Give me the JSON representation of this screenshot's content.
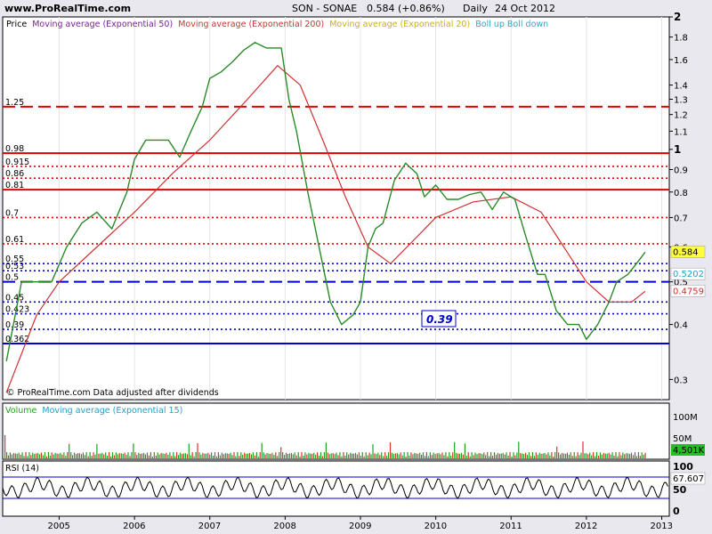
{
  "header": {
    "site": "www.ProRealTime.com",
    "symbol": "SON - SONAE",
    "price": "0.584 (+0.86%)",
    "period": "Daily",
    "date": "24 Oct 2012"
  },
  "legend": {
    "price": "Price",
    "ma50": "Moving average (Exponential 50)",
    "ma200": "Moving average (Exponential 200)",
    "ma20": "Moving average (Exponential 20)",
    "boll": "Boll up Boll down"
  },
  "footer_note": "© ProRealTime.com  Data adjusted after dividends",
  "volume_legend": {
    "volume": "Volume",
    "ma15": "Moving average (Exponential 15)"
  },
  "rsi_legend": "RSI (14)",
  "boxed_label": "0.39",
  "colors": {
    "ma50": "#7a1fa0",
    "ma200": "#d03030",
    "ma20": "#c8b400",
    "boll": "#20b0c8",
    "price": "#2a8a2a",
    "red_line": "#e00000",
    "blue_line": "#0000cc"
  },
  "chart_data": [
    {
      "type": "line",
      "scale": "log",
      "ylim": [
        0.27,
        2.0
      ],
      "xlim": [
        2004.25,
        2013.1
      ],
      "y_ticks": [
        2,
        1.8,
        1.6,
        1.4,
        1.3,
        1.2,
        1.1,
        1,
        0.9,
        0.8,
        0.7,
        0.6,
        0.5,
        0.4,
        0.3
      ],
      "x_ticks": [
        "2005",
        "2006",
        "2007",
        "2008",
        "2009",
        "2010",
        "2011",
        "2012",
        "2013"
      ],
      "x_tick_pos": [
        2005,
        2006,
        2007,
        2008,
        2009,
        2010,
        2011,
        2012,
        2013
      ],
      "red_levels": [
        {
          "value": 1.25,
          "label": "1.25",
          "style": "dashed"
        },
        {
          "value": 0.98,
          "label": "0.98",
          "style": "solid"
        },
        {
          "value": 0.915,
          "label": "0.915",
          "style": "dotted"
        },
        {
          "value": 0.86,
          "label": "0.86",
          "style": "dotted"
        },
        {
          "value": 0.81,
          "label": "0.81",
          "style": "solid"
        },
        {
          "value": 0.7,
          "label": "0.7",
          "style": "dotted"
        },
        {
          "value": 0.61,
          "label": "0.61",
          "style": "dotted"
        }
      ],
      "blue_levels": [
        {
          "value": 0.55,
          "label": "0.55",
          "style": "dotted"
        },
        {
          "value": 0.53,
          "label": "0.53",
          "style": "dotted"
        },
        {
          "value": 0.5,
          "label": "0.5",
          "style": "dashed"
        },
        {
          "value": 0.45,
          "label": "0.45",
          "style": "dotted"
        },
        {
          "value": 0.423,
          "label": "0.423",
          "style": "dotted"
        },
        {
          "value": 0.39,
          "label": "0.39",
          "style": "dotted"
        },
        {
          "value": 0.362,
          "label": "0.362",
          "style": "solid"
        }
      ],
      "price_tags": [
        {
          "value": 0.584,
          "label": "0.584",
          "bg": "#ffff40"
        },
        {
          "value": 0.5202,
          "label": "0.5202",
          "bg": "#ffffff",
          "fg": "#20a0c0"
        },
        {
          "value": 0.4759,
          "label": "0.4759",
          "bg": "#ffffff",
          "fg": "#d03030"
        }
      ],
      "series": [
        {
          "name": "Price",
          "x": [
            2004.3,
            2004.5,
            2004.7,
            2004.9,
            2005.1,
            2005.3,
            2005.5,
            2005.7,
            2005.9,
            2006.0,
            2006.15,
            2006.3,
            2006.45,
            2006.6,
            2006.75,
            2006.9,
            2007.0,
            2007.15,
            2007.3,
            2007.45,
            2007.6,
            2007.75,
            2007.85,
            2007.95,
            2008.05,
            2008.15,
            2008.3,
            2008.45,
            2008.6,
            2008.75,
            2008.9,
            2009.0,
            2009.1,
            2009.2,
            2009.3,
            2009.45,
            2009.6,
            2009.75,
            2009.85,
            2010.0,
            2010.15,
            2010.3,
            2010.45,
            2010.6,
            2010.75,
            2010.9,
            2011.05,
            2011.2,
            2011.35,
            2011.45,
            2011.6,
            2011.75,
            2011.9,
            2012.0,
            2012.15,
            2012.3,
            2012.4,
            2012.55,
            2012.7,
            2012.78
          ],
          "values": [
            0.33,
            0.5,
            0.5,
            0.5,
            0.6,
            0.68,
            0.72,
            0.66,
            0.8,
            0.95,
            1.05,
            1.05,
            1.05,
            0.96,
            1.1,
            1.25,
            1.45,
            1.5,
            1.58,
            1.68,
            1.75,
            1.7,
            1.7,
            1.7,
            1.3,
            1.1,
            0.8,
            0.6,
            0.45,
            0.4,
            0.42,
            0.45,
            0.6,
            0.66,
            0.68,
            0.85,
            0.93,
            0.88,
            0.78,
            0.83,
            0.77,
            0.77,
            0.79,
            0.8,
            0.73,
            0.8,
            0.77,
            0.63,
            0.52,
            0.52,
            0.43,
            0.4,
            0.4,
            0.37,
            0.4,
            0.45,
            0.5,
            0.52,
            0.56,
            0.584
          ]
        },
        {
          "name": "Moving average (Exponential 200)",
          "x": [
            2004.3,
            2004.7,
            2005.0,
            2005.5,
            2006.0,
            2006.5,
            2007.0,
            2007.5,
            2007.9,
            2008.2,
            2008.5,
            2008.8,
            2009.1,
            2009.4,
            2009.7,
            2010.0,
            2010.5,
            2011.0,
            2011.4,
            2011.7,
            2012.0,
            2012.3,
            2012.6,
            2012.78
          ],
          "values": [
            0.28,
            0.42,
            0.5,
            0.6,
            0.72,
            0.88,
            1.05,
            1.3,
            1.55,
            1.4,
            1.05,
            0.78,
            0.6,
            0.55,
            0.62,
            0.7,
            0.76,
            0.78,
            0.72,
            0.6,
            0.5,
            0.45,
            0.45,
            0.4759
          ]
        }
      ]
    },
    {
      "type": "bar",
      "name": "Volume",
      "y_ticks": [
        "100M",
        "50M"
      ],
      "tag": "4,501K"
    },
    {
      "type": "line",
      "name": "RSI (14)",
      "ylim": [
        0,
        100
      ],
      "y_ticks": [
        "100",
        "50",
        "0"
      ],
      "tag": "67.607"
    }
  ]
}
